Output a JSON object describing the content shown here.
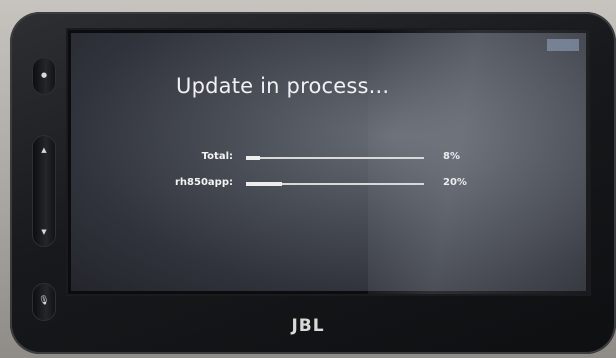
{
  "device": {
    "brand_logo": "JBL"
  },
  "screen": {
    "title": "Update in process...",
    "progress_rows": [
      {
        "label": "Total:",
        "percent_text": "8%",
        "fraction": 0.08
      },
      {
        "label": "rh850app:",
        "percent_text": "20%",
        "fraction": 0.2
      }
    ]
  },
  "hardware_buttons": {
    "top": {
      "icon": "dot-icon"
    },
    "up": {
      "icon": "triangle-up-icon"
    },
    "down": {
      "icon": "triangle-down-icon"
    },
    "voice": {
      "icon": "microphone-icon"
    }
  },
  "colors": {
    "screen_bg": "#4a4e57",
    "text": "#f1f1f3",
    "bar": "#e8e8ea",
    "bezel": "#17191c"
  }
}
